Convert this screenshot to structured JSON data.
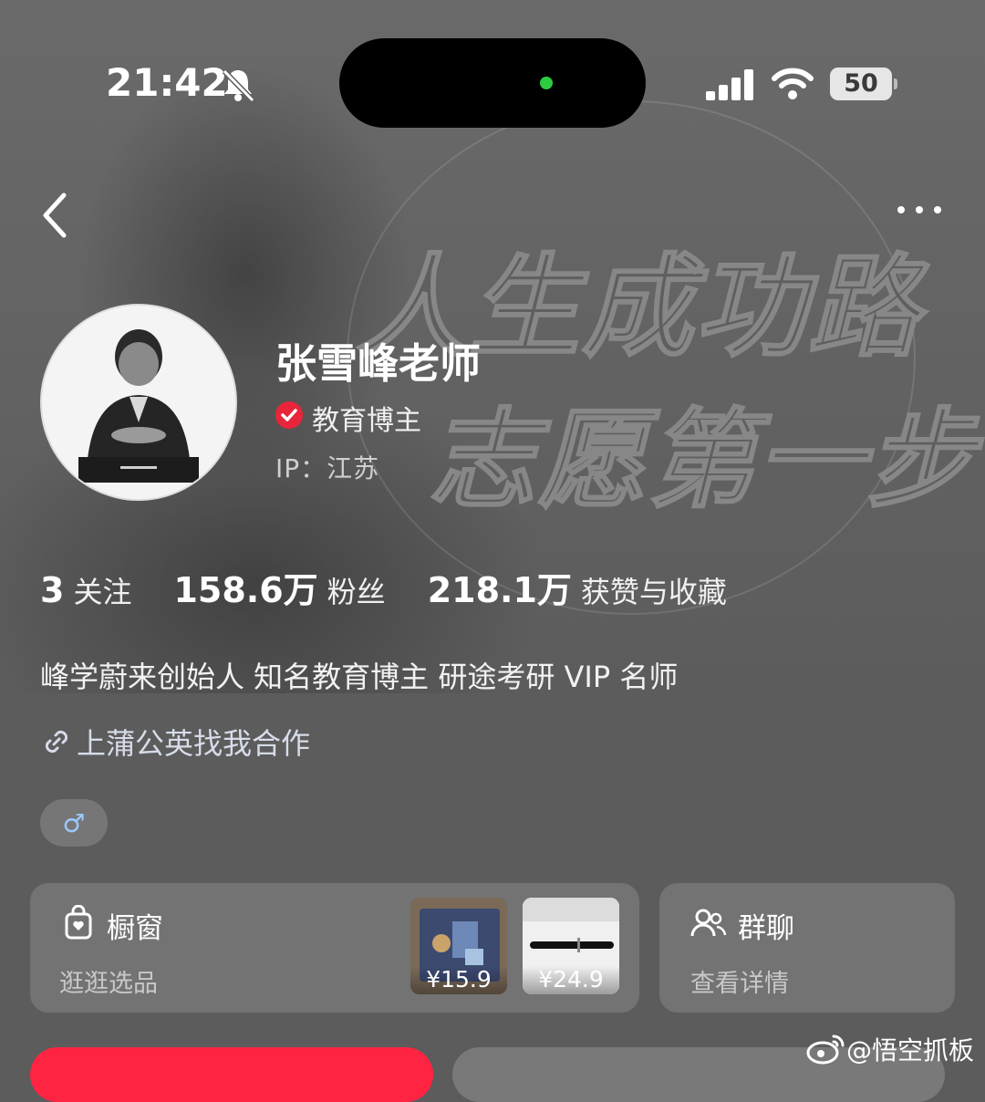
{
  "status_bar": {
    "time": "21:42",
    "battery": "50"
  },
  "banner": {
    "line1": "人生成功路",
    "line2": "志愿第一步"
  },
  "profile": {
    "name": "张雪峰老师",
    "role": "教育博主",
    "ip": "IP：江苏"
  },
  "stats": [
    {
      "value": "3",
      "label": "关注"
    },
    {
      "value": "158.6万",
      "label": "粉丝"
    },
    {
      "value": "218.1万",
      "label": "获赞与收藏"
    }
  ],
  "bio": "峰学蔚来创始人 知名教育博主 研途考研 VIP 名师",
  "link": "上蒲公英找我合作",
  "gender_symbol": "♂",
  "shop_card": {
    "title": "橱窗",
    "subtitle": "逛逛选品",
    "products": [
      {
        "price": "¥15.9"
      },
      {
        "price": "¥24.9"
      }
    ]
  },
  "group_card": {
    "title": "群聊",
    "subtitle": "查看详情"
  },
  "watermark": "@悟空抓板",
  "colors": {
    "accent": "#ff2442",
    "verified": "#e8253a",
    "island_dot": "#2ecc40"
  }
}
